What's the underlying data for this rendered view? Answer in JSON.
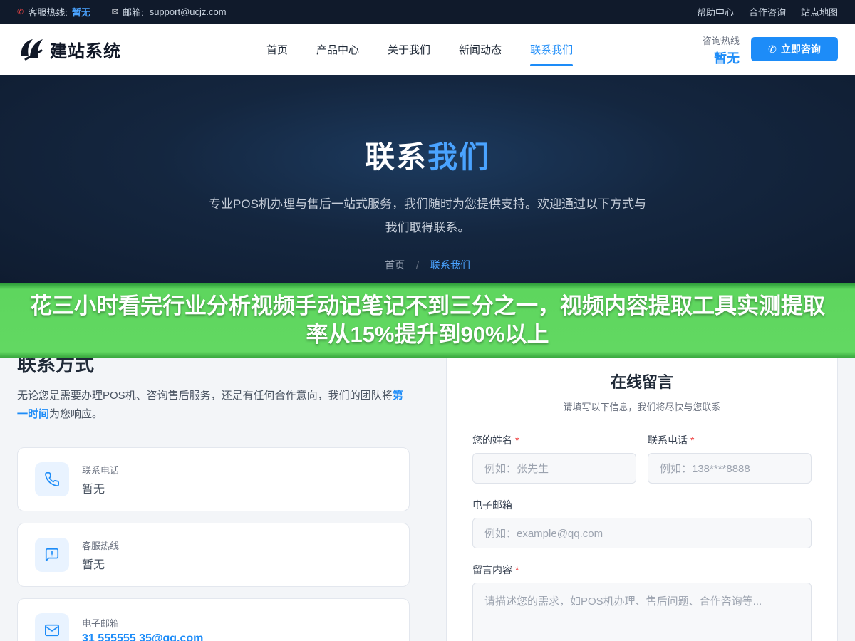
{
  "topbar": {
    "hotline_label": "客服热线:",
    "hotline_value": "暂无",
    "email_label": "邮箱:",
    "email_value": "support@ucjz.com",
    "links": [
      "帮助中心",
      "合作咨询",
      "站点地图"
    ]
  },
  "header": {
    "logo_text": "建站系统",
    "nav": [
      "首页",
      "产品中心",
      "关于我们",
      "新闻动态",
      "联系我们"
    ],
    "active_nav": "联系我们",
    "hotline_label": "咨询热线",
    "hotline_value": "暂无",
    "consult_button": "立即咨询"
  },
  "hero": {
    "title_part1": "联系",
    "title_part2": "我们",
    "description": "专业POS机办理与售后一站式服务，我们随时为您提供支持。欢迎通过以下方式与我们取得联系。",
    "breadcrumb_home": "首页",
    "breadcrumb_sep": "/",
    "breadcrumb_current": "联系我们"
  },
  "banner": {
    "text": "花三小时看完行业分析视频手动记笔记不到三分之一，视频内容提取工具实测提取率从15%提升到90%以上"
  },
  "contact": {
    "title": "联系方式",
    "desc_before": "无论您是需要办理POS机、咨询售后服务，还是有任何合作意向，我们的团队将",
    "desc_highlight": "第一时间",
    "desc_after": "为您响应。",
    "cards": [
      {
        "label": "联系电话",
        "value": "暂无",
        "icon": "phone-icon"
      },
      {
        "label": "客服热线",
        "value": "暂无",
        "icon": "message-icon"
      },
      {
        "label": "电子邮箱",
        "value": "31 555555 35@qq.com",
        "icon": "mail-icon"
      }
    ]
  },
  "form": {
    "title": "在线留言",
    "subtitle": "请填写以下信息，我们将尽快与您联系",
    "name_label": "您的姓名",
    "name_placeholder": "例如：张先生",
    "phone_label": "联系电话",
    "phone_placeholder": "例如：138****8888",
    "email_label": "电子邮箱",
    "email_placeholder": "例如：example@qq.com",
    "message_label": "留言内容",
    "message_placeholder": "请描述您的需求，如POS机办理、售后问题、合作咨询等...",
    "required_mark": "*"
  },
  "colors": {
    "accent": "#1d8cf8",
    "topbar": "#101a2b",
    "banner": "#62d862"
  }
}
